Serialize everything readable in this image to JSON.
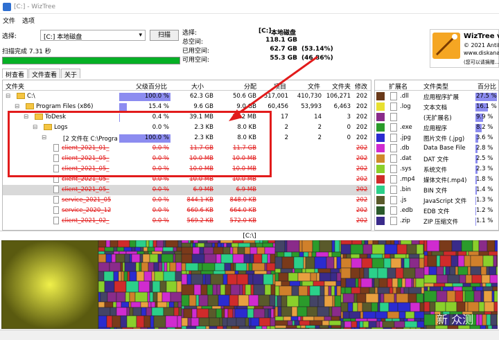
{
  "window": {
    "title": "[C:] - WizTree"
  },
  "menu": [
    "文件",
    "选项"
  ],
  "scan": {
    "select_label": "选择:",
    "drive": "[C:] 本地磁盘",
    "scan_button": "扫描",
    "status": "扫描完成 7.31 秒"
  },
  "selection": {
    "header": "选择:",
    "drive_tag": "[C:]",
    "drive_name": "本地磁盘",
    "rows": [
      {
        "key": "总空间:",
        "value": "118.1 GB",
        "pct": ""
      },
      {
        "key": "已用空间:",
        "value": "62.7 GB",
        "pct": "(53.14%)"
      },
      {
        "key": "可用空间:",
        "value": "55.3 GB",
        "pct": "(46.86%)"
      }
    ]
  },
  "logo": {
    "line1": "WizTree v4",
    "line2": "© 2021 Antibo",
    "line3": "www.diskana",
    "line4": "(您可以请捐赠...)"
  },
  "tabs": [
    "树查看",
    "文件查看",
    "关于"
  ],
  "tree": {
    "headers": [
      "文件夹",
      "父级百分比",
      "大小",
      "分配",
      "项目",
      "文件",
      "文件夹",
      "修改"
    ],
    "rows": [
      {
        "name": "C:\\",
        "pct": "100.0 %",
        "pctv": 1.0,
        "size": "62.3 GB",
        "alloc": "50.6 GB",
        "items": "517,001",
        "files": "410,730",
        "folders": "106,271",
        "mod": "202",
        "type": "drive",
        "indent": 0,
        "strike": false
      },
      {
        "name": "Program Files (x86)",
        "pct": "15.4 %",
        "pctv": 0.154,
        "size": "9.6 GB",
        "alloc": "9.0 GB",
        "items": "60,456",
        "files": "53,993",
        "folders": "6,463",
        "mod": "202",
        "type": "folder",
        "indent": 1,
        "strike": false
      },
      {
        "name": "ToDesk",
        "pct": "0.4 %",
        "pctv": 0.004,
        "size": "39.1 MB",
        "alloc": "39.2 MB",
        "items": "17",
        "files": "14",
        "folders": "3",
        "mod": "202",
        "type": "folder",
        "indent": 2,
        "strike": false
      },
      {
        "name": "Logs",
        "pct": "0.0 %",
        "pctv": 0.0,
        "size": "2.3 KB",
        "alloc": "8.0 KB",
        "items": "2",
        "files": "2",
        "folders": "0",
        "mod": "202",
        "type": "folder",
        "indent": 3,
        "strike": false
      },
      {
        "name": "[2 文件在 C:\\Program F",
        "pct": "100.0 %",
        "pctv": 1.0,
        "size": "2.3 KB",
        "alloc": "8.0 KB",
        "items": "2",
        "files": "2",
        "folders": "0",
        "mod": "202",
        "type": "file",
        "indent": 4,
        "strike": false
      },
      {
        "name": "client_2021_01_",
        "pct": "0.0 %",
        "pctv": 0,
        "size": "11.7 GB",
        "alloc": "11.7 GB",
        "items": "",
        "files": "",
        "folders": "",
        "mod": "202",
        "type": "file",
        "indent": 5,
        "strike": true
      },
      {
        "name": "client_2021_05_",
        "pct": "0.0 %",
        "pctv": 0,
        "size": "10.0 MB",
        "alloc": "10.0 MB",
        "items": "",
        "files": "",
        "folders": "",
        "mod": "202",
        "type": "file",
        "indent": 5,
        "strike": true
      },
      {
        "name": "client_2021_05_",
        "pct": "0.0 %",
        "pctv": 0,
        "size": "10.0 MB",
        "alloc": "10.0 MB",
        "items": "",
        "files": "",
        "folders": "",
        "mod": "202",
        "type": "file",
        "indent": 5,
        "strike": true
      },
      {
        "name": "client_2021_05_",
        "pct": "0.0 %",
        "pctv": 0,
        "size": "10.0 MB",
        "alloc": "10.0 MB",
        "items": "",
        "files": "",
        "folders": "",
        "mod": "202",
        "type": "file",
        "indent": 5,
        "strike": true
      },
      {
        "name": "client_2021_05_",
        "pct": "0.0 %",
        "pctv": 0,
        "size": "6.9 MB",
        "alloc": "6.9 MB",
        "items": "",
        "files": "",
        "folders": "",
        "mod": "202",
        "type": "file",
        "indent": 5,
        "strike": true
      },
      {
        "name": "service_2021_05",
        "pct": "0.0 %",
        "pctv": 0,
        "size": "844.1 KB",
        "alloc": "848.0 KB",
        "items": "",
        "files": "",
        "folders": "",
        "mod": "202",
        "type": "file",
        "indent": 5,
        "strike": true
      },
      {
        "name": "service_2020_12",
        "pct": "0.0 %",
        "pctv": 0,
        "size": "660.6 KB",
        "alloc": "664.0 KB",
        "items": "",
        "files": "",
        "folders": "",
        "mod": "202",
        "type": "file",
        "indent": 5,
        "strike": true
      },
      {
        "name": "client_2021_02_",
        "pct": "0.0 %",
        "pctv": 0,
        "size": "569.2 KB",
        "alloc": "572.0 KB",
        "items": "",
        "files": "",
        "folders": "",
        "mod": "202",
        "type": "file",
        "indent": 5,
        "strike": true
      }
    ]
  },
  "extensions": {
    "headers": [
      "扩展名",
      "文件类型",
      "百分比"
    ],
    "rows": [
      {
        "ext": ".dll",
        "type": "应用程序扩展",
        "pct": "27.5 %",
        "pctv": 0.275,
        "color": "#6a3a1a"
      },
      {
        "ext": ".log",
        "type": "文本文档",
        "pct": "16.1 %",
        "pctv": 0.161,
        "color": "#e8e030"
      },
      {
        "ext": "",
        "type": "(无扩展名)",
        "pct": "9.9 %",
        "pctv": 0.099,
        "color": "#8a2b8a"
      },
      {
        "ext": ".exe",
        "type": "应用程序",
        "pct": "8.2 %",
        "pctv": 0.082,
        "color": "#2b9b2b"
      },
      {
        "ext": ".jpg",
        "type": "图片文件 (.jpg)",
        "pct": "3.6 %",
        "pctv": 0.036,
        "color": "#2b2bd0"
      },
      {
        "ext": ".db",
        "type": "Data Base File",
        "pct": "2.8 %",
        "pctv": 0.028,
        "color": "#d02bd0"
      },
      {
        "ext": ".dat",
        "type": "DAT 文件",
        "pct": "2.5 %",
        "pctv": 0.025,
        "color": "#d08a2b"
      },
      {
        "ext": ".sys",
        "type": "系统文件",
        "pct": "2.3 %",
        "pctv": 0.023,
        "color": "#8ad02b"
      },
      {
        "ext": ".mp4",
        "type": "媒体文件(.mp4)",
        "pct": "1.8 %",
        "pctv": 0.018,
        "color": "#d02b2b"
      },
      {
        "ext": ".bin",
        "type": "BIN 文件",
        "pct": "1.4 %",
        "pctv": 0.014,
        "color": "#2bd08a"
      },
      {
        "ext": ".js",
        "type": "JavaScript 文件",
        "pct": "1.3 %",
        "pctv": 0.013,
        "color": "#5a5a2b"
      },
      {
        "ext": ".edb",
        "type": "EDB 文件",
        "pct": "1.2 %",
        "pctv": 0.012,
        "color": "#2b5a2b"
      },
      {
        "ext": ".zip",
        "type": "ZIP 压缩文件",
        "pct": "1.1 %",
        "pctv": 0.011,
        "color": "#3a2b8a"
      }
    ]
  },
  "treemap": {
    "path": "[C:\\]"
  },
  "watermark": "新 众测"
}
